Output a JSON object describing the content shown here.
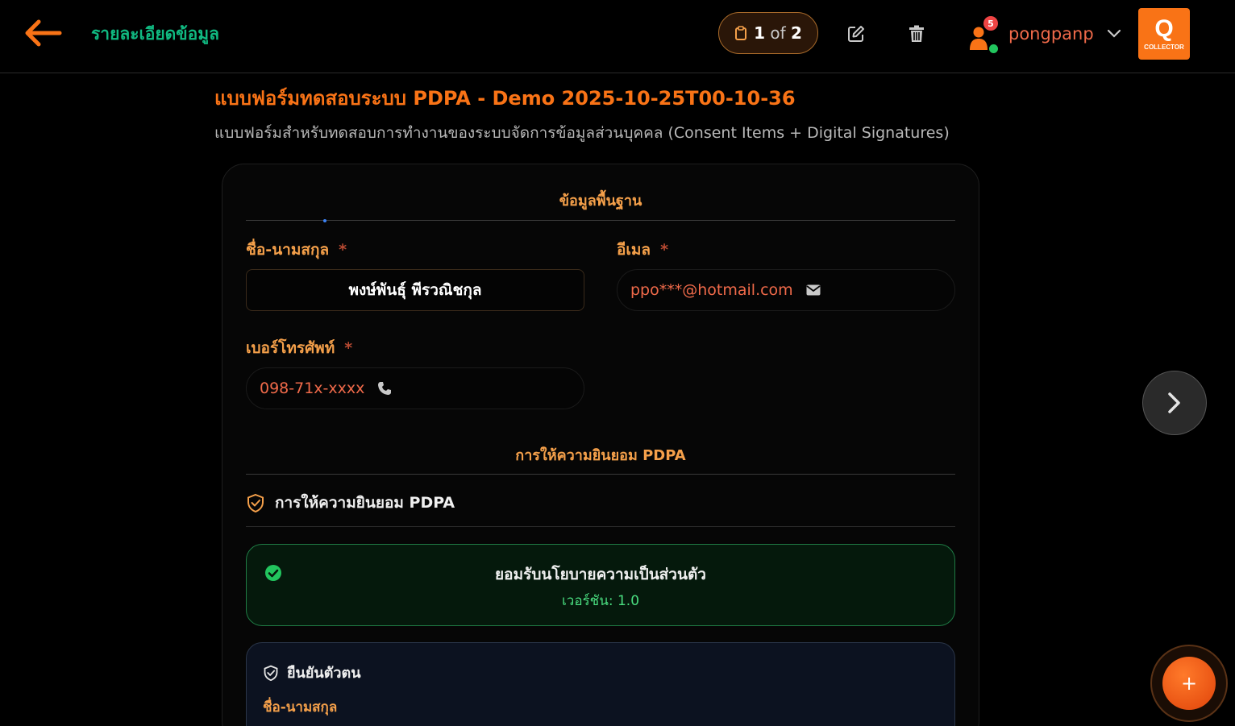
{
  "header": {
    "title": "รายละเอียดข้อมูล",
    "pager": {
      "current": "1",
      "of": "of",
      "total": "2"
    },
    "notification_count": "5",
    "username": "pongpanp",
    "logo": {
      "letter": "Q",
      "text": "COLLECTOR"
    }
  },
  "form": {
    "title": "แบบฟอร์มทดสอบระบบ PDPA - Demo 2025-10-25T00-10-36",
    "description": "แบบฟอร์มสำหรับทดสอบการทำงานของระบบจัดการข้อมูลส่วนบุคคล (Consent Items + Digital Signatures)"
  },
  "sections": {
    "basic": "ข้อมูลพื้นฐาน",
    "pdpa": "การให้ความยินยอม PDPA"
  },
  "fields": {
    "name": {
      "label": "ชื่อ-นามสกุล",
      "required": "*",
      "value": "พงษ์พันธุ์ พีรวณิชกุล"
    },
    "email": {
      "label": "อีเมล",
      "required": "*",
      "value": "ppo***@hotmail.com"
    },
    "phone": {
      "label": "เบอร์โทรศัพท์",
      "required": "*",
      "value": "098-71x-xxxx"
    }
  },
  "consent": {
    "heading": "การให้ความยินยอม PDPA",
    "item_title": "ยอมรับนโยบายความเป็นส่วนตัว",
    "item_version": "เวอร์ชัน: 1.0"
  },
  "verify": {
    "heading": "ยืนยันตัวตน",
    "name_label": "ชื่อ-นามสกุล"
  },
  "fab": {
    "label": "+"
  },
  "colors": {
    "accent": "#f97316",
    "heading_green": "#10b981",
    "label_orange": "#f5a04a",
    "success": "#22c55e",
    "danger": "#ef4444"
  }
}
